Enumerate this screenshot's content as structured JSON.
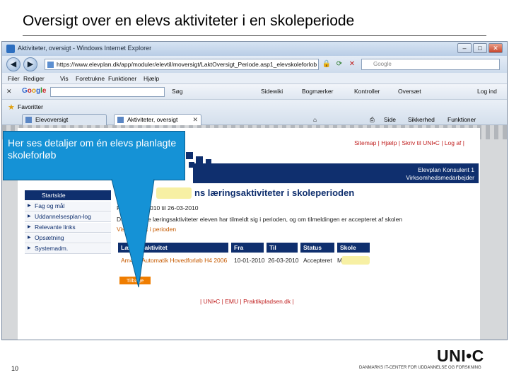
{
  "slide": {
    "title": "Oversigt over en elevs aktiviteter i en skoleperiode",
    "page_number": "10"
  },
  "browser": {
    "window_title": "Aktiviteter, oversigt - Windows Internet Explorer",
    "address": "https://www.elevplan.dk/app/moduler/elevtil/moversigt/LaktOversigt_Periode.asp1_elevskoleforlob",
    "search_placeholder": "Google",
    "menu": [
      "Filer",
      "Rediger",
      "Vis",
      "Foretrukne",
      "Funktioner",
      "Hjælp"
    ],
    "google_toolbar": {
      "logo": "Google",
      "items": [
        "Søg",
        "Sidewiki",
        "Bogmærker",
        "Kontroller",
        "Oversæt",
        "Log ind"
      ]
    },
    "favorites_label": "Favoritter",
    "tabs": [
      {
        "label": "Elevoversigt",
        "active": false
      },
      {
        "label": "Aktiviteter, oversigt",
        "active": true
      }
    ],
    "commands": [
      "Side",
      "Sikkerhed",
      "Funktioner"
    ]
  },
  "page": {
    "top_links": "Sitemap | Hjælp | Skriv til UNI•C | Log af |",
    "user_line1": "Elevplan Konsulent 1",
    "user_line2": "Virksomhedsmedarbejder",
    "sidebar": {
      "start": "Startside",
      "items": [
        "Fag og mål",
        "Uddannelsesplan-log",
        "Relevante links",
        "Opsætning",
        "Systemadm."
      ]
    },
    "heading": "ns læringsaktiviteter i skoleperioden",
    "period_label": "Peri",
    "period_text": "01-2010 til 26-03-2010",
    "description_start": "Du ka",
    "description_end": "e læringsaktiviteter eleven har tilmeldt sig i perioden, og om tilmeldingen er accepteret af skolen",
    "see_link_start": "Vis udb",
    "see_link_end": "t i perioden",
    "table": {
      "headers": [
        "Læringsaktivitet",
        "Fra",
        "Til",
        "Status",
        "Skole"
      ],
      "row": [
        "Am4h - Automatik Hovedforløb H4 2006",
        "10-01-2010",
        "26-03-2010",
        "Accepteret",
        "M"
      ]
    },
    "back_button": "Tilbage",
    "footer_links": "| UNI•C | EMU | Praktikpladsen.dk |"
  },
  "callout": {
    "text": "Her ses detaljer om én elevs planlagte skoleforløb"
  },
  "branding": {
    "logo": "UNI•C",
    "tagline": "DANMARKS IT-CENTER FOR UDDANNELSE OG FORSKNING"
  },
  "colors": {
    "navy": "#0f2f6e",
    "orange": "#ef7d00",
    "callout": "#1592d6",
    "link_red": "#c02020"
  }
}
